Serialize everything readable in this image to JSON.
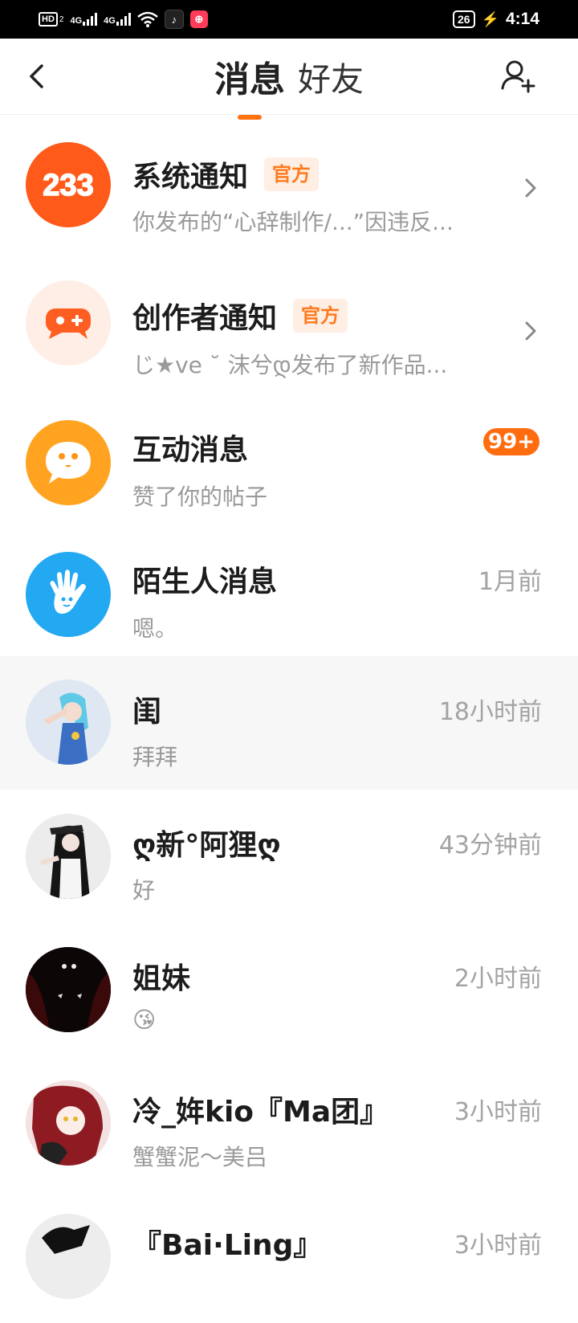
{
  "status_bar": {
    "hd_label": "HD",
    "sim_slot": "2",
    "network_1": "4G",
    "network_2": "4G",
    "battery": "26",
    "time": "4:14",
    "icons": [
      "hd-icon",
      "signal-icon",
      "signal-icon",
      "wifi-icon",
      "tiktok-app-icon",
      "233-app-icon",
      "charging-icon"
    ]
  },
  "header": {
    "tabs": [
      {
        "label": "消息",
        "active": true
      },
      {
        "label": "好友",
        "active": false
      }
    ],
    "accent_color": "#ff7210"
  },
  "messages": [
    {
      "title": "系统通知",
      "official_badge": "官方",
      "preview": "你发布的“心辞制作/...”因违反...",
      "avatar": "233-logo-avatar",
      "trailing": "chevron"
    },
    {
      "title": "创作者通知",
      "official_badge": "官方",
      "preview": "じ★ve ˘ 沫兮დ发布了新作品...",
      "avatar": "gamepad-avatar",
      "trailing": "chevron"
    },
    {
      "title": "互动消息",
      "preview": "赞了你的帖子",
      "avatar": "chat-face-avatar",
      "unread": "99+"
    },
    {
      "title": "陌生人消息",
      "preview": "嗯。",
      "avatar": "hand-avatar",
      "time": "1月前"
    },
    {
      "title": "闺",
      "preview": "拜拜",
      "avatar": "user-avatar",
      "time": "18小时前",
      "highlight": true
    },
    {
      "title": "ღ新°阿狸ღ",
      "preview": "好",
      "avatar": "user-avatar",
      "time": "43分钟前"
    },
    {
      "title": "姐妹",
      "preview": "😘",
      "avatar": "user-avatar",
      "time": "2小时前"
    },
    {
      "title": "冷_姩kio『Ma团』",
      "preview": "蟹蟹泥～美吕",
      "avatar": "user-avatar",
      "time": "3小时前"
    },
    {
      "title": "『Bai·Ling』",
      "preview": "",
      "avatar": "user-avatar",
      "time": "3小时前"
    }
  ]
}
